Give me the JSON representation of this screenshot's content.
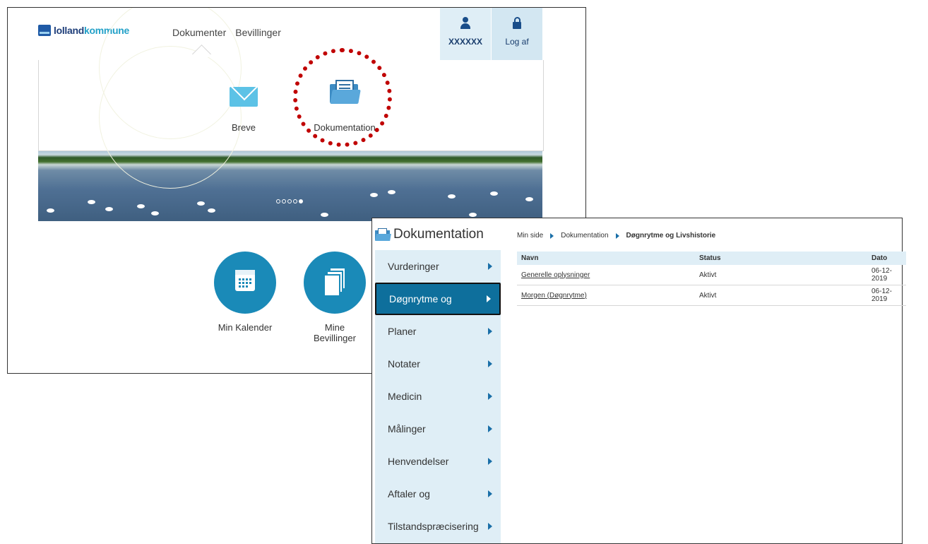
{
  "portal": {
    "logo": {
      "part1": "lolland",
      "part2": "kommune"
    },
    "nav": [
      "Dokumenter",
      "Bevillinger"
    ],
    "user_name": "XXXXXX",
    "logout_label": "Log af",
    "dropdown": {
      "breve": "Breve",
      "dokumentation": "Dokumentation"
    },
    "tiles": {
      "kalender": "Min Kalender",
      "bevillinger_line1": "Mine",
      "bevillinger_line2": "Bevillinger"
    },
    "carousel": {
      "count": 5,
      "active_index": 4
    }
  },
  "docs": {
    "title": "Dokumentation",
    "sidebar": [
      {
        "label": "Vurderinger"
      },
      {
        "label": "Døgnrytme og",
        "active": true
      },
      {
        "label": "Planer"
      },
      {
        "label": "Notater"
      },
      {
        "label": "Medicin"
      },
      {
        "label": "Målinger"
      },
      {
        "label": "Henvendelser"
      },
      {
        "label": "Aftaler og"
      },
      {
        "label": "Tilstandspræcisering"
      }
    ],
    "breadcrumb": [
      "Min side",
      "Dokumentation",
      "Døgnrytme og Livshistorie"
    ],
    "table": {
      "headers": [
        "Navn",
        "Status",
        "Dato"
      ],
      "rows": [
        [
          "Generelle oplysninger",
          "Aktivt",
          "06-12-2019"
        ],
        [
          "Morgen (Døgnrytme)",
          "Aktivt",
          "06-12-2019"
        ]
      ]
    }
  },
  "colors": {
    "accent": "#1a8ab8",
    "sidebar_bg": "#dfeef6",
    "active_item": "#0e6f9c",
    "highlight_ring": "#c00000"
  }
}
